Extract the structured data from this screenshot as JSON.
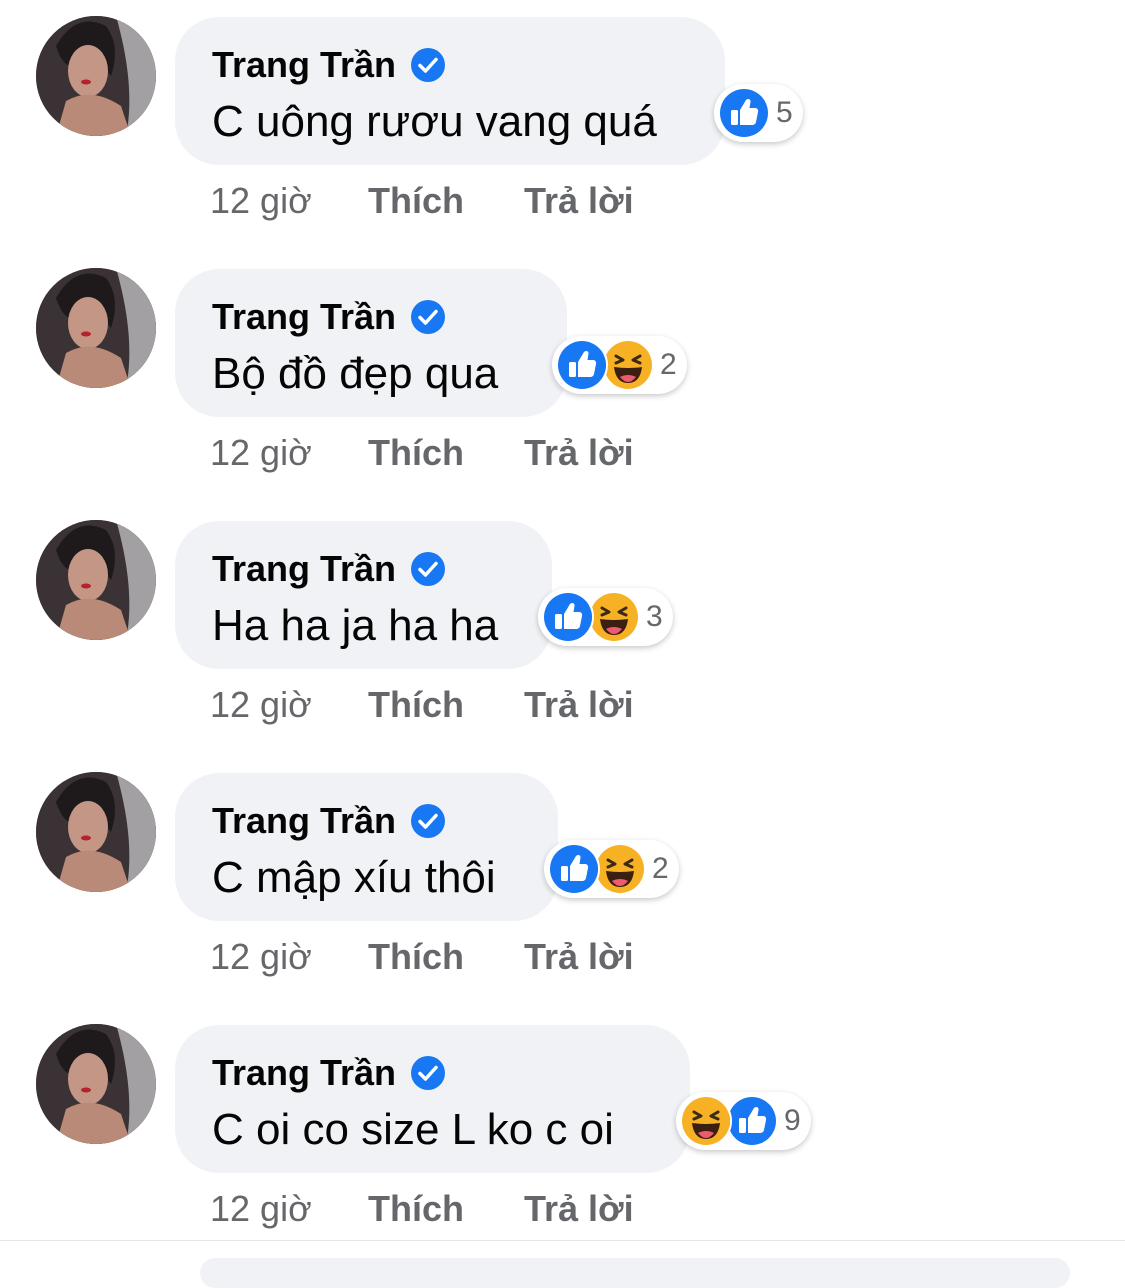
{
  "colors": {
    "like_blue": "#1877f2",
    "verified_blue": "#1877f2",
    "haha_yellow": "#f7b125",
    "bubble_bg": "#f0f2f5",
    "meta_text": "#65676b"
  },
  "comments": [
    {
      "author": "Trang Trần",
      "verified": true,
      "text": "C uông rươu vang quá",
      "reactions": [
        "like-icon"
      ],
      "reaction_count": "5",
      "time": "12 giờ",
      "like_label": "Thích",
      "reply_label": "Trả lời"
    },
    {
      "author": "Trang Trần",
      "verified": true,
      "text": "Bộ đồ đẹp qua",
      "reactions": [
        "like-icon",
        "haha-icon"
      ],
      "reaction_count": "2",
      "time": "12 giờ",
      "like_label": "Thích",
      "reply_label": "Trả lời"
    },
    {
      "author": "Trang Trần",
      "verified": true,
      "text": "Ha ha ja ha ha",
      "reactions": [
        "like-icon",
        "haha-icon"
      ],
      "reaction_count": "3",
      "time": "12 giờ",
      "like_label": "Thích",
      "reply_label": "Trả lời"
    },
    {
      "author": "Trang Trần",
      "verified": true,
      "text": "C mập xíu thôi",
      "reactions": [
        "like-icon",
        "haha-icon"
      ],
      "reaction_count": "2",
      "time": "12 giờ",
      "like_label": "Thích",
      "reply_label": "Trả lời"
    },
    {
      "author": "Trang Trần",
      "verified": true,
      "text": "C oi co size L ko c oi",
      "reactions": [
        "haha-icon",
        "like-icon"
      ],
      "reaction_count": "9",
      "time": "12 giờ",
      "like_label": "Thích",
      "reply_label": "Trả lời"
    }
  ]
}
